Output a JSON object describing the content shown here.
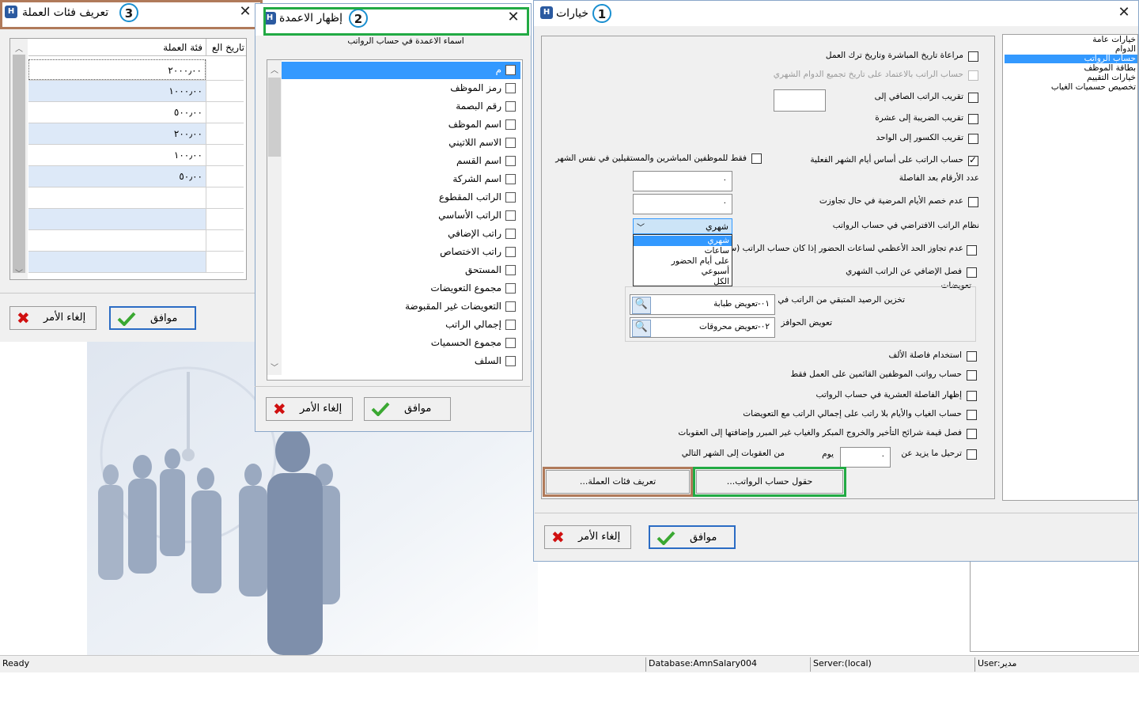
{
  "status": {
    "ready": "Ready",
    "database": "Database:AmnSalary004",
    "server": "Server:(local)",
    "user": "User:مدير"
  },
  "colors": {
    "highlight_blue": "#3399ff",
    "badge_border": "#1a8fd0",
    "box_brown": "#b07a5a",
    "box_green": "#22aa44",
    "ok_border": "#2b6cc4"
  },
  "dialog1": {
    "badge": "1",
    "title": "خيارات",
    "tree": [
      "خيارات عامة",
      "الدوام",
      "حساب الرواتب",
      "بطاقة الموظف",
      "خيارات التقييم",
      "تخصيص حسميات الغياب"
    ],
    "tree_selected_index": 2,
    "options": {
      "opt1": "مراعاة تاريخ المباشرة وتاريخ ترك العمل",
      "opt2": "حساب الراتب بالاعتماد على تاريخ تجميع الدوام الشهري",
      "opt3": "تقريب الراتب الصافي إلى",
      "opt4": "تقريب الضريبة إلى عشرة",
      "opt5": "تقريب الكسور إلى الواحد",
      "opt6": "حساب الراتب على أساس أيام الشهر الفعلية",
      "opt6b": "فقط للموظفين المباشرين والمستقيلين في نفس الشهر",
      "decimal_digits": "عدد الأرقام بعد الفاصلة",
      "decimal_value": "٠",
      "sick_days": "عدم خصم الأيام المرضية في حال تجاوزت",
      "sick_value": "٠",
      "default_system": "نظام الراتب الافتراضي في حساب الرواتب",
      "dropdown_value": "شهري",
      "dropdown_options": [
        "شهري",
        "ساعات",
        "على أيام الحضور",
        "أسبوعي",
        "الكل"
      ],
      "max_hours": "عدم تجاوز الحد الأعظمي لساعات الحضور إذا كان حساب الراتب (ساعات)",
      "separate_extra": "فصل الإضافي عن الراتب الشهري",
      "compensations": "تعويضات",
      "store_balance": "تخزين الرصيد المتبقي من الراتب في",
      "store_balance_value": "٠١-تعويض طبابة",
      "incentives": "تعويض الحوافز",
      "incentives_value": "٠٢-تعويض محروقات",
      "thousand_sep": "استخدام فاصلة الألف",
      "only_active": "حساب رواتب الموظفين القائمين على العمل فقط",
      "show_decimal": "إظهار الفاصلة العشرية في حساب الرواتب",
      "absence_calc": "حساب الغياب والأيام بلا راتب على إجمالي الراتب مع التعويضات",
      "separate_penalties": "فصل قيمة شرائح التأخير والخروج المبكر والغياب غير المبرر وإضافتها إلى العقوبات",
      "carry_over": "ترحيل ما يزيد عن",
      "carry_value": "٠",
      "day_unit": "يوم",
      "carry_tail": "من العقوبات إلى الشهر التالي"
    },
    "btn_salary_fields": "حقول حساب الرواتب...",
    "btn_currency": "تعريف فئات العملة...",
    "ok": "موافق",
    "cancel": "إلغاء الأمر"
  },
  "dialog2": {
    "badge": "2",
    "title": "إظهار الاعمدة",
    "header": "اسماء الاعمدة في حساب الرواتب",
    "columns": [
      "م",
      "رمز الموظف",
      "رقم البصمة",
      "اسم الموظف",
      "الاسم اللاتيني",
      "اسم القسم",
      "اسم الشركة",
      "الراتب المقطوع",
      "الراتب الأساسي",
      "راتب الإضافي",
      "راتب الاختصاص",
      "المستحق",
      "مجموع التعويضات",
      "التعويضات غير المقبوضة",
      "إجمالي الراتب",
      "مجموع الحسميات",
      "السلف"
    ],
    "ok": "موافق",
    "cancel": "إلغاء الأمر"
  },
  "dialog3": {
    "badge": "3",
    "title": "تعريف فئات العملة",
    "col_category": "فئة العملة",
    "col_date": "تاريخ الع",
    "values": [
      "٢٠٠٠٫٠٠",
      "١٠٠٠٫٠٠",
      "٥٠٠٫٠٠",
      "٢٠٠٫٠٠",
      "١٠٠٫٠٠",
      "٥٠٫٠٠",
      "",
      "",
      "",
      ""
    ],
    "ok": "موافق",
    "cancel": "إلغاء الأمر"
  }
}
